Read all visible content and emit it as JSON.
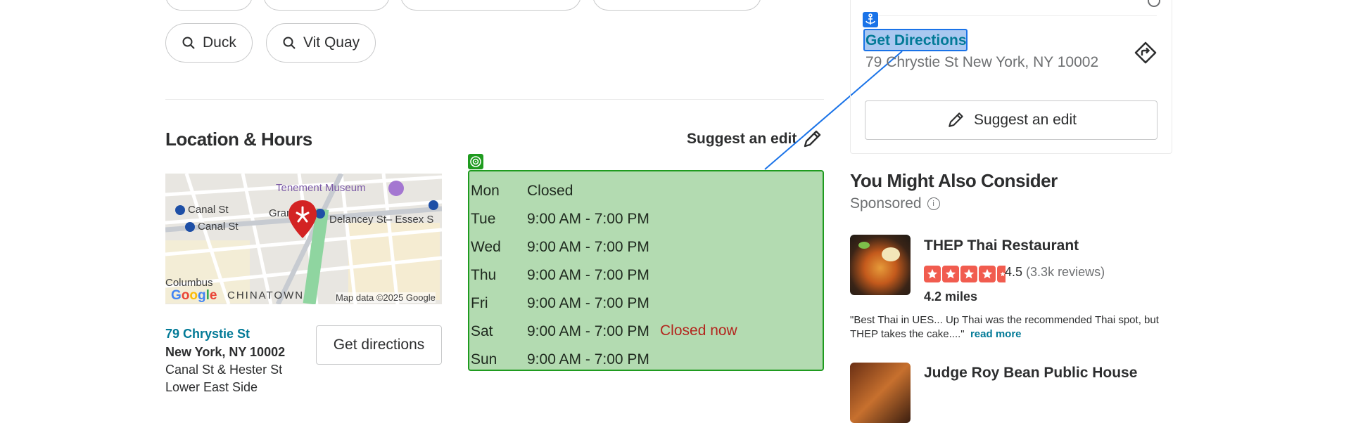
{
  "tags": [
    {
      "label": "Duck"
    },
    {
      "label": "Vit Quay"
    }
  ],
  "location": {
    "title": "Location & Hours",
    "suggest_edit": "Suggest an edit",
    "map": {
      "labels": {
        "museum": "Tenement Museum",
        "canal1": "Canal St",
        "canal2": "Canal St",
        "grand": "Gran",
        "delancey": "Delancey St– Essex S",
        "columbus": "Columbus",
        "chinatown": "CHINATOWN",
        "attribution": "Map data ©2025 Google"
      }
    },
    "address": {
      "street": "79 Chrystie St",
      "city": "New York, NY 10002",
      "cross": "Canal St & Hester St",
      "neighborhood": "Lower East Side"
    },
    "get_directions": "Get directions",
    "hours": [
      {
        "day": "Mon",
        "time": "Closed"
      },
      {
        "day": "Tue",
        "time": "9:00 AM - 7:00 PM"
      },
      {
        "day": "Wed",
        "time": "9:00 AM - 7:00 PM"
      },
      {
        "day": "Thu",
        "time": "9:00 AM - 7:00 PM"
      },
      {
        "day": "Fri",
        "time": "9:00 AM - 7:00 PM"
      },
      {
        "day": "Sat",
        "time": "9:00 AM - 7:00 PM"
      },
      {
        "day": "Sun",
        "time": "9:00 AM - 7:00 PM"
      }
    ],
    "status": "Closed now"
  },
  "sidebar": {
    "get_directions": "Get Directions",
    "address": "79 Chrystie St New York, NY 10002",
    "suggest_edit": "Suggest an edit"
  },
  "consider": {
    "title": "You Might Also Consider",
    "sponsored": "Sponsored",
    "items": [
      {
        "name": "THEP Thai Restaurant",
        "rating": "4.5",
        "reviews": "(3.3k reviews)",
        "distance": "4.2 miles",
        "quote": "\"Best Thai in UES... Up Thai was the recommended Thai spot, but THEP takes the cake....\"",
        "read_more": "read more"
      },
      {
        "name": "Judge Roy Bean Public House"
      }
    ]
  },
  "colors": {
    "link": "#027a97",
    "star": "#f15c4f",
    "highlight_green": "#b3dbb1",
    "highlight_blue": "#a9c8f0",
    "closed": "#b3261e"
  }
}
